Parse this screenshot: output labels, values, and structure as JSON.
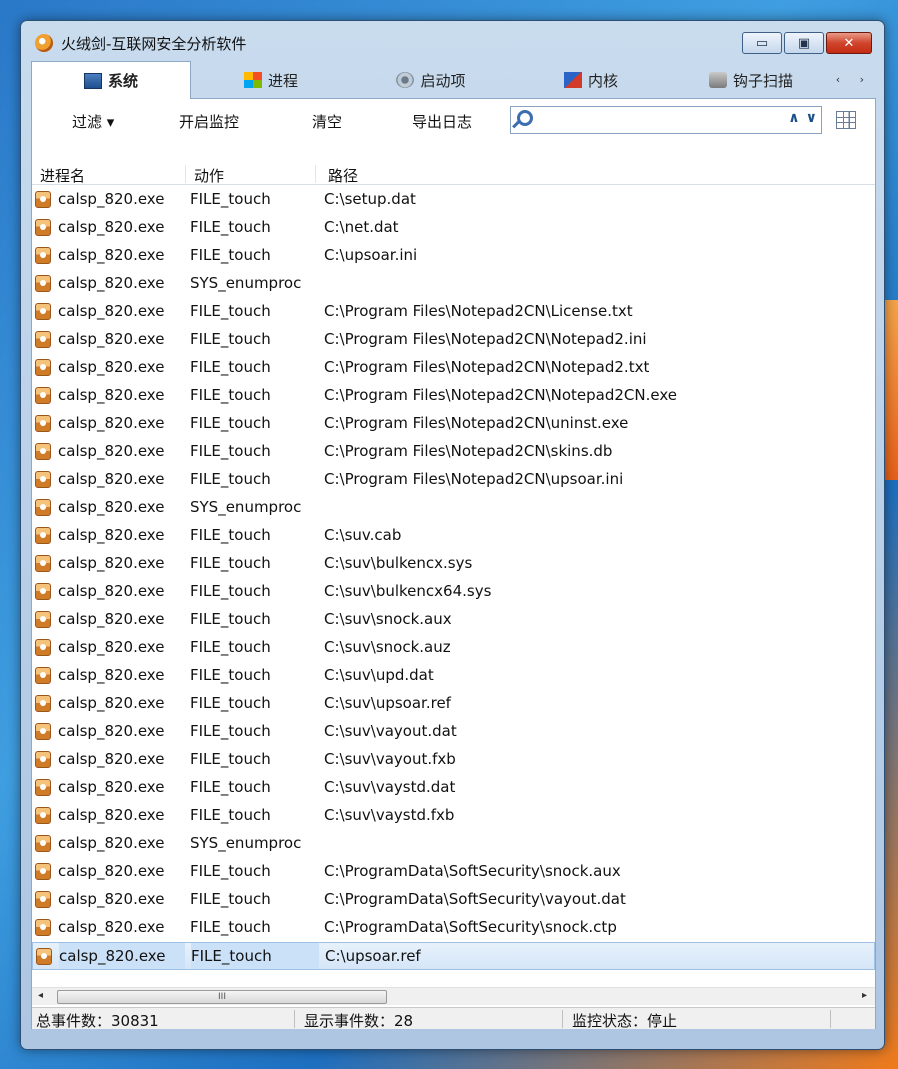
{
  "window": {
    "title": "火绒剑-互联网安全分析软件",
    "min_label": "▭",
    "max_label": "▣",
    "close_label": "✕"
  },
  "tabs": [
    {
      "label": "系统",
      "icon": "system-icon",
      "active": true
    },
    {
      "label": "进程",
      "icon": "windows-flag-icon",
      "active": false
    },
    {
      "label": "启动项",
      "icon": "gear-icon",
      "active": false
    },
    {
      "label": "内核",
      "icon": "kernel-icon",
      "active": false
    },
    {
      "label": "钩子扫描",
      "icon": "hook-icon",
      "active": false
    }
  ],
  "tab_nav": "‹ ›",
  "toolbar": {
    "filter_label": "过滤 ▾",
    "start_monitor_label": "开启监控",
    "clear_label": "清空",
    "export_log_label": "导出日志",
    "search_placeholder": "",
    "search_up": "∧",
    "search_down": "∨"
  },
  "table": {
    "headers": [
      "进程名",
      "动作",
      "路径"
    ],
    "rows": [
      {
        "name": "calsp_820.exe",
        "action": "FILE_touch",
        "path": "C:\\setup.dat"
      },
      {
        "name": "calsp_820.exe",
        "action": "FILE_touch",
        "path": "C:\\net.dat"
      },
      {
        "name": "calsp_820.exe",
        "action": "FILE_touch",
        "path": "C:\\upsoar.ini"
      },
      {
        "name": "calsp_820.exe",
        "action": "SYS_enumproc",
        "path": ""
      },
      {
        "name": "calsp_820.exe",
        "action": "FILE_touch",
        "path": "C:\\Program Files\\Notepad2CN\\License.txt"
      },
      {
        "name": "calsp_820.exe",
        "action": "FILE_touch",
        "path": "C:\\Program Files\\Notepad2CN\\Notepad2.ini"
      },
      {
        "name": "calsp_820.exe",
        "action": "FILE_touch",
        "path": "C:\\Program Files\\Notepad2CN\\Notepad2.txt"
      },
      {
        "name": "calsp_820.exe",
        "action": "FILE_touch",
        "path": "C:\\Program Files\\Notepad2CN\\Notepad2CN.exe"
      },
      {
        "name": "calsp_820.exe",
        "action": "FILE_touch",
        "path": "C:\\Program Files\\Notepad2CN\\uninst.exe"
      },
      {
        "name": "calsp_820.exe",
        "action": "FILE_touch",
        "path": "C:\\Program Files\\Notepad2CN\\skins.db"
      },
      {
        "name": "calsp_820.exe",
        "action": "FILE_touch",
        "path": "C:\\Program Files\\Notepad2CN\\upsoar.ini"
      },
      {
        "name": "calsp_820.exe",
        "action": "SYS_enumproc",
        "path": ""
      },
      {
        "name": "calsp_820.exe",
        "action": "FILE_touch",
        "path": "C:\\suv.cab"
      },
      {
        "name": "calsp_820.exe",
        "action": "FILE_touch",
        "path": "C:\\suv\\bulkencx.sys"
      },
      {
        "name": "calsp_820.exe",
        "action": "FILE_touch",
        "path": "C:\\suv\\bulkencx64.sys"
      },
      {
        "name": "calsp_820.exe",
        "action": "FILE_touch",
        "path": "C:\\suv\\snock.aux"
      },
      {
        "name": "calsp_820.exe",
        "action": "FILE_touch",
        "path": "C:\\suv\\snock.auz"
      },
      {
        "name": "calsp_820.exe",
        "action": "FILE_touch",
        "path": "C:\\suv\\upd.dat"
      },
      {
        "name": "calsp_820.exe",
        "action": "FILE_touch",
        "path": "C:\\suv\\upsoar.ref"
      },
      {
        "name": "calsp_820.exe",
        "action": "FILE_touch",
        "path": "C:\\suv\\vayout.dat"
      },
      {
        "name": "calsp_820.exe",
        "action": "FILE_touch",
        "path": "C:\\suv\\vayout.fxb"
      },
      {
        "name": "calsp_820.exe",
        "action": "FILE_touch",
        "path": "C:\\suv\\vaystd.dat"
      },
      {
        "name": "calsp_820.exe",
        "action": "FILE_touch",
        "path": "C:\\suv\\vaystd.fxb"
      },
      {
        "name": "calsp_820.exe",
        "action": "SYS_enumproc",
        "path": ""
      },
      {
        "name": "calsp_820.exe",
        "action": "FILE_touch",
        "path": "C:\\ProgramData\\SoftSecurity\\snock.aux"
      },
      {
        "name": "calsp_820.exe",
        "action": "FILE_touch",
        "path": "C:\\ProgramData\\SoftSecurity\\vayout.dat"
      },
      {
        "name": "calsp_820.exe",
        "action": "FILE_touch",
        "path": "C:\\ProgramData\\SoftSecurity\\snock.ctp"
      },
      {
        "name": "calsp_820.exe",
        "action": "FILE_touch",
        "path": "C:\\upsoar.ref",
        "selected": true
      }
    ]
  },
  "scrollbar": {
    "left": "◂",
    "right": "▸",
    "thumb_grip": "III"
  },
  "status": {
    "total_events": "总事件数：30831",
    "shown_events": "显示事件数：28",
    "monitor_state": "监控状态：停止"
  }
}
